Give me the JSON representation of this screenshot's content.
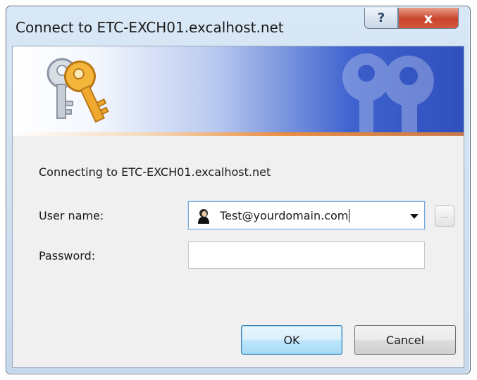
{
  "window": {
    "title": "Connect to ETC-EXCH01.excalhost.net",
    "help_label": "?",
    "close_label": "x"
  },
  "banner": {
    "icon": "keys-icon",
    "colors": {
      "banner_start": "#ffffff",
      "banner_end": "#2f4fbd",
      "accent_line": "#e98c3f"
    }
  },
  "form": {
    "connecting_text": "Connecting to ETC-EXCH01.excalhost.net",
    "user_label": "User name:",
    "user_value": "Test@yourdomain.com",
    "user_icon": "user-icon",
    "browse_label": "...",
    "password_label": "Password:",
    "password_value": ""
  },
  "buttons": {
    "ok_label": "OK",
    "cancel_label": "Cancel"
  }
}
